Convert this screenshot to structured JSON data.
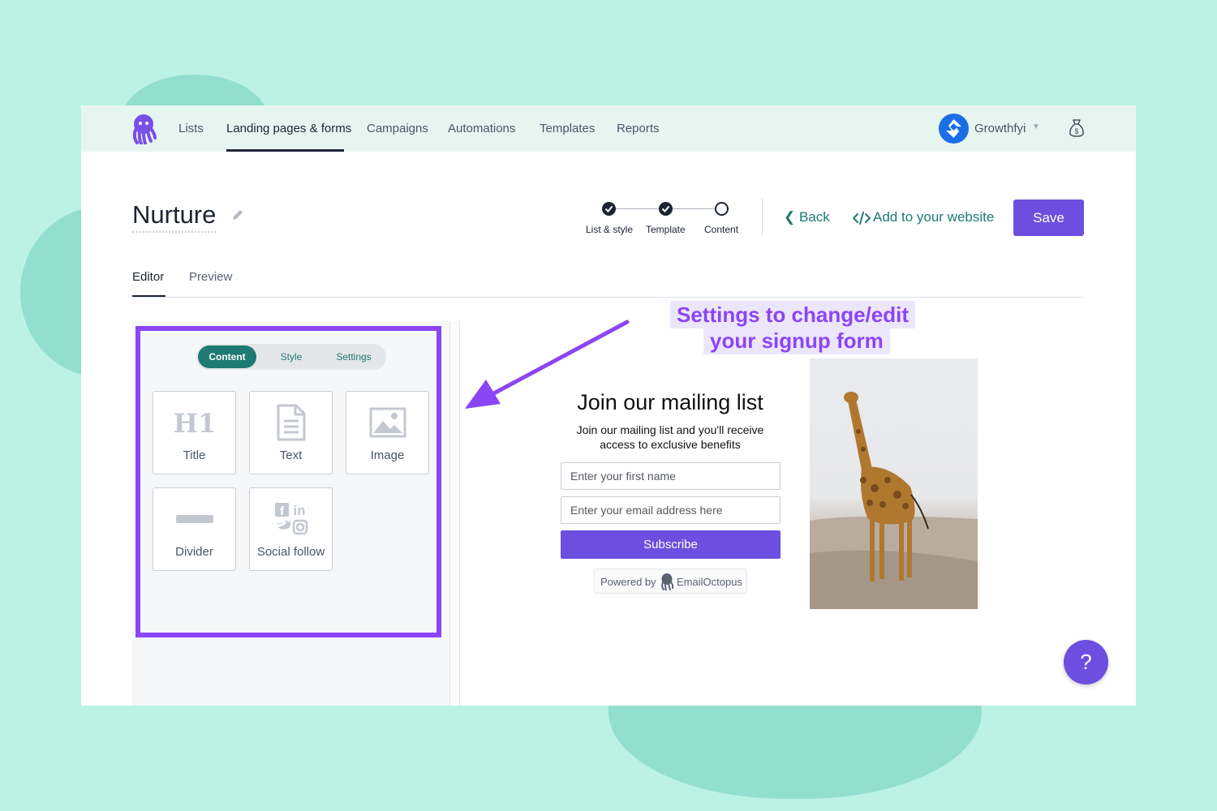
{
  "nav": {
    "items": [
      {
        "label": "Lists"
      },
      {
        "label": "Landing pages & forms"
      },
      {
        "label": "Campaigns"
      },
      {
        "label": "Automations"
      },
      {
        "label": "Templates"
      },
      {
        "label": "Reports"
      }
    ],
    "active_index": 1,
    "account_name": "Growthfyi",
    "logo_icon": "octopus-logo-icon",
    "bag_icon": "money-bag-icon"
  },
  "header": {
    "title": "Nurture",
    "steps": [
      {
        "label": "List & style",
        "status": "done"
      },
      {
        "label": "Template",
        "status": "done"
      },
      {
        "label": "Content",
        "status": "current"
      }
    ],
    "back_label": "Back",
    "embed_label": "Add to your website",
    "save_label": "Save"
  },
  "tabs": [
    {
      "label": "Editor"
    },
    {
      "label": "Preview"
    }
  ],
  "panel": {
    "segments": [
      {
        "label": "Content"
      },
      {
        "label": "Style"
      },
      {
        "label": "Settings"
      }
    ],
    "blocks": [
      {
        "label": "Title",
        "icon": "h1-icon"
      },
      {
        "label": "Text",
        "icon": "document-icon"
      },
      {
        "label": "Image",
        "icon": "image-icon"
      },
      {
        "label": "Divider",
        "icon": "divider-icon"
      },
      {
        "label": "Social follow",
        "icon": "social-icon"
      }
    ]
  },
  "annotation": {
    "line1": "Settings to change/edit",
    "line2": "your signup form"
  },
  "form": {
    "title": "Join our mailing list",
    "subtitle_line1": "Join our mailing list and you'll receive",
    "subtitle_line2": "access to exclusive benefits",
    "first_name_placeholder": "Enter your first name",
    "email_placeholder": "Enter your email address here",
    "subscribe_label": "Subscribe",
    "powered_by": "Powered by",
    "powered_brand": "EmailOctopus"
  },
  "help_label": "?",
  "colors": {
    "accent": "#6c4fe0",
    "teal": "#1e7a73",
    "highlight": "#8b45f5",
    "background": "#bbf2e4"
  }
}
